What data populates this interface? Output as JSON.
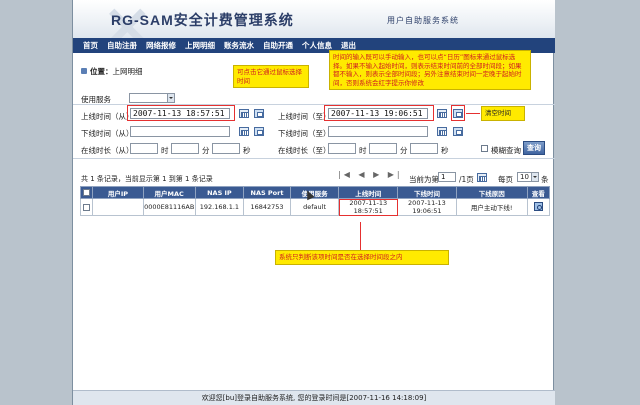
{
  "header": {
    "logo_text": "RG-SAM安全计费管理系统",
    "subtitle": "用户自助服务系统"
  },
  "nav": [
    "首页",
    "自助注册",
    "网络报修",
    "上网明细",
    "账务流水",
    "自助开通",
    "个人信息",
    "退出"
  ],
  "location": {
    "label": "位置：",
    "value": "上网明细"
  },
  "form": {
    "service_label": "使用服务",
    "login_from_label": "上线时间（从）",
    "login_from_value": "2007-11-13 18:57:51",
    "login_to_label": "上线时间（至）",
    "login_to_value": "2007-11-13 19:06:51",
    "logout_from_label": "下线时间（从）",
    "logout_to_label": "下线时间（至）",
    "online_from_label": "在线时长（从）",
    "online_to_label": "在线时长（至）",
    "hour": "时",
    "minute": "分",
    "second": "秒",
    "fuzzy_label": "模糊查询",
    "query_button": "查询"
  },
  "notes": {
    "calendar_tip": "可点击它通过鼠标选择时间",
    "input_tip": "时间的输入既可以手动输入，也可以点“日历”图标来通过鼠标选择。如果不输入起始时间，则表示结束时间前的全部时间段；如果都不输入，则表示全部时间段；另外注意结束时间一定晚于起始时间，否则系统会红字提示你修改",
    "clear_tip": "清空时间",
    "check_tip": "系统只判断该项时间是否在选择时间段之内"
  },
  "stats": {
    "text": "共 1 条记录，当前显示第 1 到第 1 条记录",
    "current_label": "当前为第",
    "page": "1",
    "page_suffix": "/1页",
    "per_page_label": "每页",
    "per_page": "10",
    "per_page_suffix": "条"
  },
  "table": {
    "headers": [
      "用户IP",
      "用户MAC",
      "NAS IP",
      "NAS Port",
      "使用服务",
      "上线时间",
      "下线时间",
      "下线原因",
      "查看"
    ],
    "rows": [
      {
        "ip": "",
        "mac": "0000E81116AB",
        "nas_ip": "192.168.1.1",
        "nas_port": "16842753",
        "service": "default",
        "login": "2007-11-13 18:57:51",
        "logout": "2007-11-13 19:06:51",
        "reason": "用户主动下线!"
      }
    ]
  },
  "footer": "欢迎您[bu]登录自助服务系统, 您的登录时间是[2007-11-16 14:18:09]"
}
